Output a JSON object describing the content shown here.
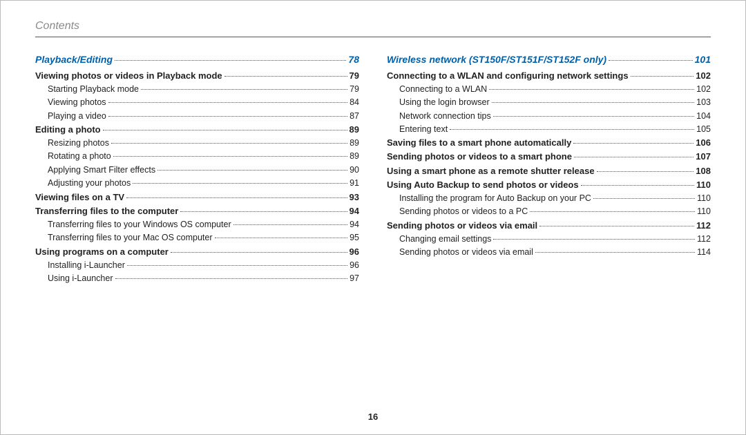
{
  "header": "Contents",
  "page_number": "16",
  "left": {
    "section": {
      "label": "Playback/Editing",
      "page": "78"
    },
    "items": [
      {
        "type": "topic",
        "label": "Viewing photos or videos in Playback mode",
        "page": "79"
      },
      {
        "type": "sub",
        "label": "Starting Playback mode",
        "page": "79"
      },
      {
        "type": "sub",
        "label": "Viewing photos",
        "page": "84"
      },
      {
        "type": "sub",
        "label": "Playing a video",
        "page": "87"
      },
      {
        "type": "topic",
        "label": "Editing a photo",
        "page": "89"
      },
      {
        "type": "sub",
        "label": "Resizing photos",
        "page": "89"
      },
      {
        "type": "sub",
        "label": "Rotating a photo",
        "page": "89"
      },
      {
        "type": "sub",
        "label": "Applying Smart Filter effects",
        "page": "90"
      },
      {
        "type": "sub",
        "label": "Adjusting your photos",
        "page": "91"
      },
      {
        "type": "topic",
        "label": "Viewing files on a TV",
        "page": "93"
      },
      {
        "type": "topic",
        "label": "Transferring files to the computer",
        "page": "94"
      },
      {
        "type": "sub",
        "label": "Transferring files to your Windows OS computer",
        "page": "94"
      },
      {
        "type": "sub",
        "label": "Transferring files to your Mac OS computer",
        "page": "95"
      },
      {
        "type": "topic",
        "label": "Using programs on a computer",
        "page": "96"
      },
      {
        "type": "sub",
        "label": "Installing i-Launcher",
        "page": "96"
      },
      {
        "type": "sub",
        "label": "Using i-Launcher",
        "page": "97"
      }
    ]
  },
  "right": {
    "section": {
      "label": "Wireless network (ST150F/ST151F/ST152F only)",
      "page": "101"
    },
    "items": [
      {
        "type": "topic",
        "label": "Connecting to a WLAN and configuring network settings",
        "page": "102"
      },
      {
        "type": "sub",
        "label": "Connecting to a WLAN",
        "page": "102"
      },
      {
        "type": "sub",
        "label": "Using the login browser",
        "page": "103"
      },
      {
        "type": "sub",
        "label": "Network connection tips",
        "page": "104"
      },
      {
        "type": "sub",
        "label": "Entering text",
        "page": "105"
      },
      {
        "type": "topic",
        "label": "Saving files to a smart phone automatically",
        "page": "106"
      },
      {
        "type": "topic",
        "label": "Sending photos or videos to a smart phone",
        "page": "107"
      },
      {
        "type": "topic",
        "label": "Using a smart phone as a remote shutter release",
        "page": "108"
      },
      {
        "type": "topic",
        "label": "Using Auto Backup to send photos or videos",
        "page": "110"
      },
      {
        "type": "sub",
        "label": "Installing the program for Auto Backup on your PC",
        "page": "110"
      },
      {
        "type": "sub",
        "label": "Sending photos or videos to a PC",
        "page": "110"
      },
      {
        "type": "topic",
        "label": "Sending photos or videos via email",
        "page": "112"
      },
      {
        "type": "sub",
        "label": "Changing email settings",
        "page": "112"
      },
      {
        "type": "sub",
        "label": "Sending photos or videos via email",
        "page": "114"
      }
    ]
  }
}
